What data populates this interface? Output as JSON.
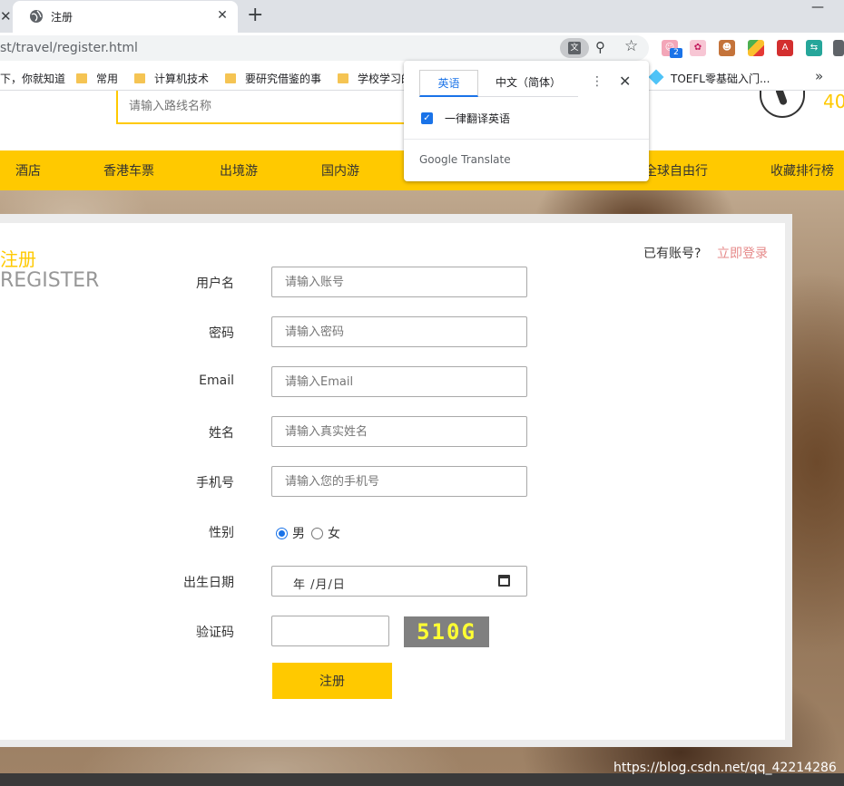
{
  "browser": {
    "tab_title": "注册",
    "prev_tab_close": "✕",
    "tab_close": "✕",
    "new_tab": "+",
    "minimize": "—",
    "url": "st/travel/register.html",
    "bookmarks": [
      {
        "label": "下，你就知道",
        "folder": false
      },
      {
        "label": "常用",
        "folder": true
      },
      {
        "label": "计算机技术",
        "folder": true
      },
      {
        "label": "要研究借鉴的事",
        "folder": true
      },
      {
        "label": "学校学习的",
        "folder": true
      },
      {
        "label": "TOEFL零基础入门...",
        "folder": false
      }
    ],
    "bookmarks_more": "»",
    "ext_badge": "2"
  },
  "translate_popup": {
    "tab_source": "英语",
    "tab_target": "中文（简体）",
    "menu": "⋮",
    "close": "✕",
    "always_translate_label": "一律翻译英语",
    "brand": "Google Translate"
  },
  "header": {
    "search_placeholder": "请输入路线名称",
    "hotline_partial": "40"
  },
  "nav": {
    "items": [
      "酒店",
      "香港车票",
      "出境游",
      "国内游",
      "全球自由行",
      "收藏排行榜"
    ]
  },
  "register": {
    "title_cn": "注册",
    "title_en": "REGISTER",
    "have_account": "已有账号?",
    "login_link": "立即登录",
    "fields": {
      "username": {
        "label": "用户名",
        "placeholder": "请输入账号"
      },
      "password": {
        "label": "密码",
        "placeholder": "请输入密码"
      },
      "email": {
        "label": "Email",
        "placeholder": "请输入Email"
      },
      "name": {
        "label": "姓名",
        "placeholder": "请输入真实姓名"
      },
      "phone": {
        "label": "手机号",
        "placeholder": "请输入您的手机号"
      },
      "gender": {
        "label": "性别",
        "options": [
          "男",
          "女"
        ],
        "selected": "男"
      },
      "birthday": {
        "label": "出生日期",
        "value_display": "年 /月/日"
      },
      "captcha": {
        "label": "验证码",
        "image_text": "510G"
      }
    },
    "submit_label": "注册"
  },
  "watermark": "https://blog.csdn.net/qq_42214286",
  "colors": {
    "accent": "#ffc900",
    "login_link": "#e68a8a",
    "title_en": "#979797",
    "chrome_blue": "#1a73e8"
  }
}
